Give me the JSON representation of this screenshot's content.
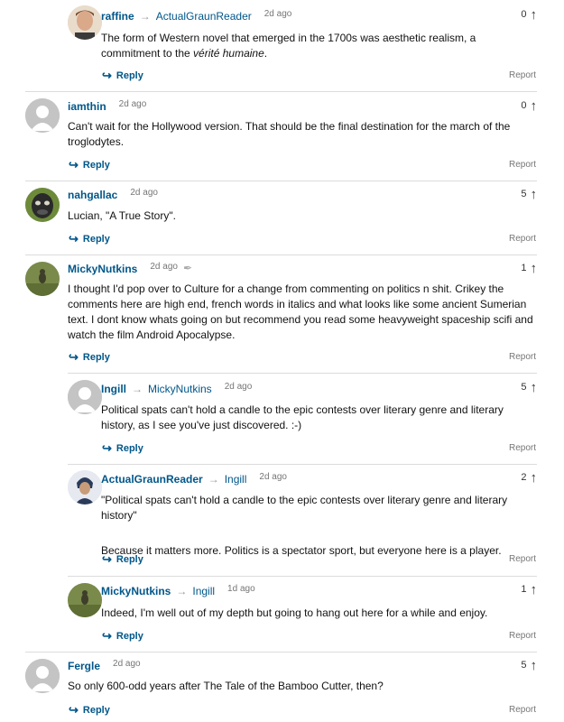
{
  "actions": {
    "reply": "Reply",
    "report": "Report"
  },
  "icons": {
    "reply": "reply-arrow-icon",
    "reply_to": "right-arrow-icon",
    "recommend": "up-arrow-icon",
    "attachment": "paperclip-icon"
  },
  "comments": [
    {
      "user": "raffine",
      "reply_to": "ActualGraunReader",
      "date": "2d ago",
      "recommends": "0",
      "text_pre": "The form of Western novel that emerged in the 1700s was aesthetic realism, a commitment to the ",
      "text_em": "vérité humaine",
      "text_post": "."
    },
    {
      "user": "iamthin",
      "date": "2d ago",
      "recommends": "0",
      "text": "Can't wait for the Hollywood version. That should be the final destination for the march of the troglodytes."
    },
    {
      "user": "nahgallac",
      "date": "2d ago",
      "recommends": "5",
      "text": "Lucian, \"A True Story\"."
    },
    {
      "user": "MickyNutkins",
      "date": "2d ago",
      "recommends": "1",
      "text": "I thought I'd pop over to Culture for a change from commenting on politics n shit. Crikey the comments here are high end, french words in italics and what looks like some ancient Sumerian text. I dont know whats going on but recommend you read some heavyweight spaceship scifi and watch the film Android Apocalypse."
    },
    {
      "user": "Ingill",
      "reply_to": "MickyNutkins",
      "date": "2d ago",
      "recommends": "5",
      "text": "Political spats can't hold a candle to the epic contests over literary genre and literary history, as I see you've just discovered. :-)"
    },
    {
      "user": "ActualGraunReader",
      "reply_to": "Ingill",
      "date": "2d ago",
      "recommends": "2",
      "text": "\"Political spats can't hold a candle to the epic contests over literary genre and literary history\"",
      "text2": "Because it matters more. Politics is a spectator sport, but everyone here is a player."
    },
    {
      "user": "MickyNutkins",
      "reply_to": "Ingill",
      "date": "1d ago",
      "recommends": "1",
      "text": "Indeed, I'm well out of my depth but going to hang out here for a while and enjoy."
    },
    {
      "user": "Fergle",
      "date": "2d ago",
      "recommends": "5",
      "text": "So only 600-odd years after The Tale of the Bamboo Cutter, then?"
    }
  ]
}
